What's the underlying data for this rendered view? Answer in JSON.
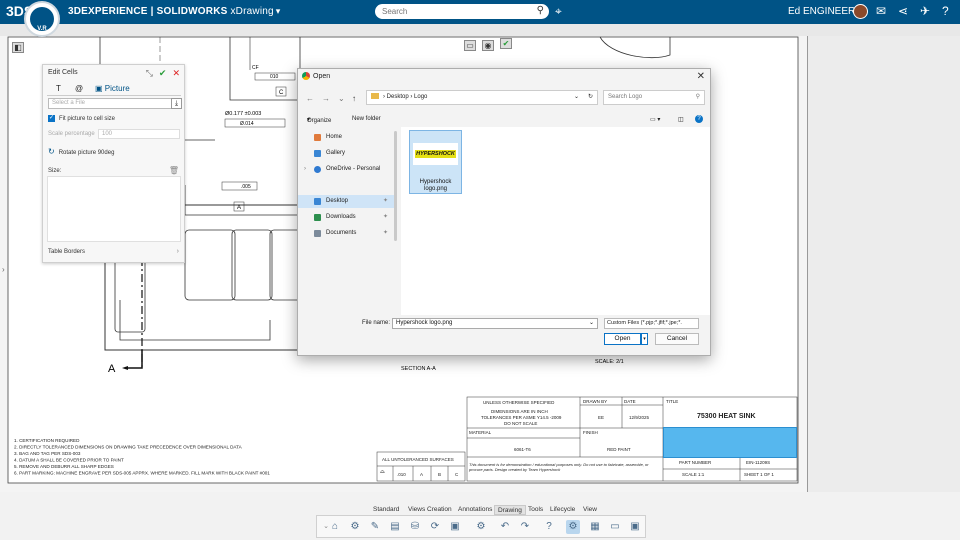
{
  "topbar": {
    "brand_logo": "3DS",
    "compass_version": "V.R",
    "brand": "3DEXPERIENCE | SOLIDWORKS",
    "app": "xDrawing",
    "search_placeholder": "Search",
    "user": "Ed ENGINEER",
    "accent": "#005386"
  },
  "edit_cells": {
    "title": "Edit Cells",
    "tabs": [
      "T",
      "@",
      "Picture"
    ],
    "file_placeholder": "Select a File",
    "fit_picture": "Fit picture to cell size",
    "scale_percentage_label": "Scale percentage",
    "scale_percentage_value": "100",
    "rotate": "Rotate picture 90deg",
    "size_label": "Size:",
    "table_borders": "Table Borders"
  },
  "open_dialog": {
    "title": "Open",
    "breadcrumb": [
      "Desktop",
      "Logo"
    ],
    "search_placeholder": "Search Logo",
    "organize": "Organize",
    "new_folder": "New folder",
    "nav_items": [
      {
        "label": "Home",
        "color": "#e07a3c"
      },
      {
        "label": "Gallery",
        "color": "#3a86d4"
      },
      {
        "label": "OneDrive - Personal",
        "color": "#2f7ad1"
      },
      {
        "label": "Desktop",
        "color": "#3a86d4"
      },
      {
        "label": "Downloads",
        "color": "#2d8f4e"
      },
      {
        "label": "Documents",
        "color": "#7b8a9a"
      }
    ],
    "file": {
      "name": "Hypershock logo.png",
      "thumb_text": "HYPERSHOCK"
    },
    "file_name_label": "File name:",
    "file_name_value": "Hypershock logo.png",
    "file_type": "Custom Files (*.pjp;*.jfif;*.jpe;*.",
    "open_label": "Open",
    "cancel_label": "Cancel"
  },
  "drawing": {
    "scale_view": "SCALE: 2/1",
    "section_label": "SECTION A-A",
    "label_a": "A",
    "datum_c": "C",
    "datum_a": "A",
    "fcf_top": "010",
    "fcf_mid": "Ø.014",
    "fcf_low": ".005",
    "dim": "Ø0.177 ±0.003",
    "label_cf": "CF",
    "notes": [
      "1. CERTIFICATION REQUIRED",
      "2. DIRECTLY TOLERANCED DIMENSIONS ON DRAWING TAKE PRECEDENCE OVER DIMENSIONAL DATA",
      "3. BAG AND TAG PER SDS-003",
      "4. DATUM A SHALL BE COVERED PRIOR TO PAINT",
      "5. REMOVE AND DEBURR ALL SHARP EDGES",
      "6. PART MARKING: MACHINE ENGRAVE PER SDS-005 APPRX. WHERE MARKED. FILL MARK WITH BLACK PAINT #001"
    ],
    "title_block": {
      "unless": "UNLESS OTHERWISE SPECIFIED",
      "dims_in": "DIMENSIONS ARE IN INCH",
      "tol": "TOLERANCES PER ASME Y14.5 -2009",
      "noscale": "DO NOT SCALE",
      "drawn_by_label": "DRAWN BY",
      "drawn_by": "EE",
      "date_label": "DATE",
      "date": "12/9/2025",
      "title_label": "TITLE",
      "title": "75300 HEAT SINK",
      "material_label": "MATERIAL",
      "material": "6061-T6",
      "finish_label": "FINISH",
      "finish": "RED PAINT",
      "untoleranced": "ALL UNTOLERANCED SURFACES",
      "prof": ".010",
      "datum_refs": [
        "A",
        "B",
        "C"
      ],
      "disclaimer": "This document is for demonstration / educational purposes only. Do not use to fabricate, assemble, or procure parts. Design created by Team Hypershock",
      "part_number_label": "PART NUMBER",
      "part_number": "EIN-11209S",
      "scale": "SCALE 1:1",
      "sheet": "SHEET 1 OF 1"
    }
  },
  "bottom_tabs": [
    "Standard",
    "Views Creation",
    "Annotations",
    "Drawing",
    "Tools",
    "Lifecycle",
    "View"
  ],
  "active_bottom_tab": "Drawing"
}
